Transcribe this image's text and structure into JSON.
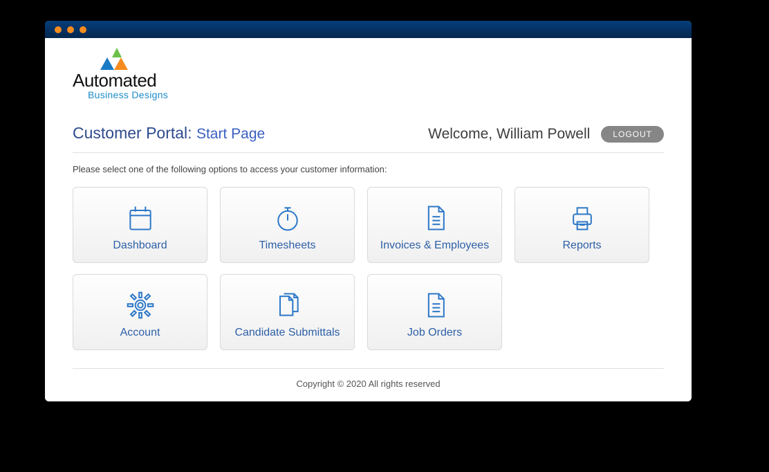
{
  "logo": {
    "name": "Automated",
    "sub": "Business Designs"
  },
  "header": {
    "title_prefix": "Customer Portal:",
    "title_page": "Start Page",
    "welcome_prefix": "Welcome,",
    "user_name": "William Powell",
    "logout_label": "LOGOUT"
  },
  "instruction": "Please select one of the following options to access your customer information:",
  "tiles": {
    "dashboard": "Dashboard",
    "timesheets": "Timesheets",
    "invoices_employees": "Invoices & Employees",
    "reports": "Reports",
    "account": "Account",
    "candidate_submittals": "Candidate Submittals",
    "job_orders": "Job Orders"
  },
  "footer": "Copyright © 2020 All rights reserved"
}
